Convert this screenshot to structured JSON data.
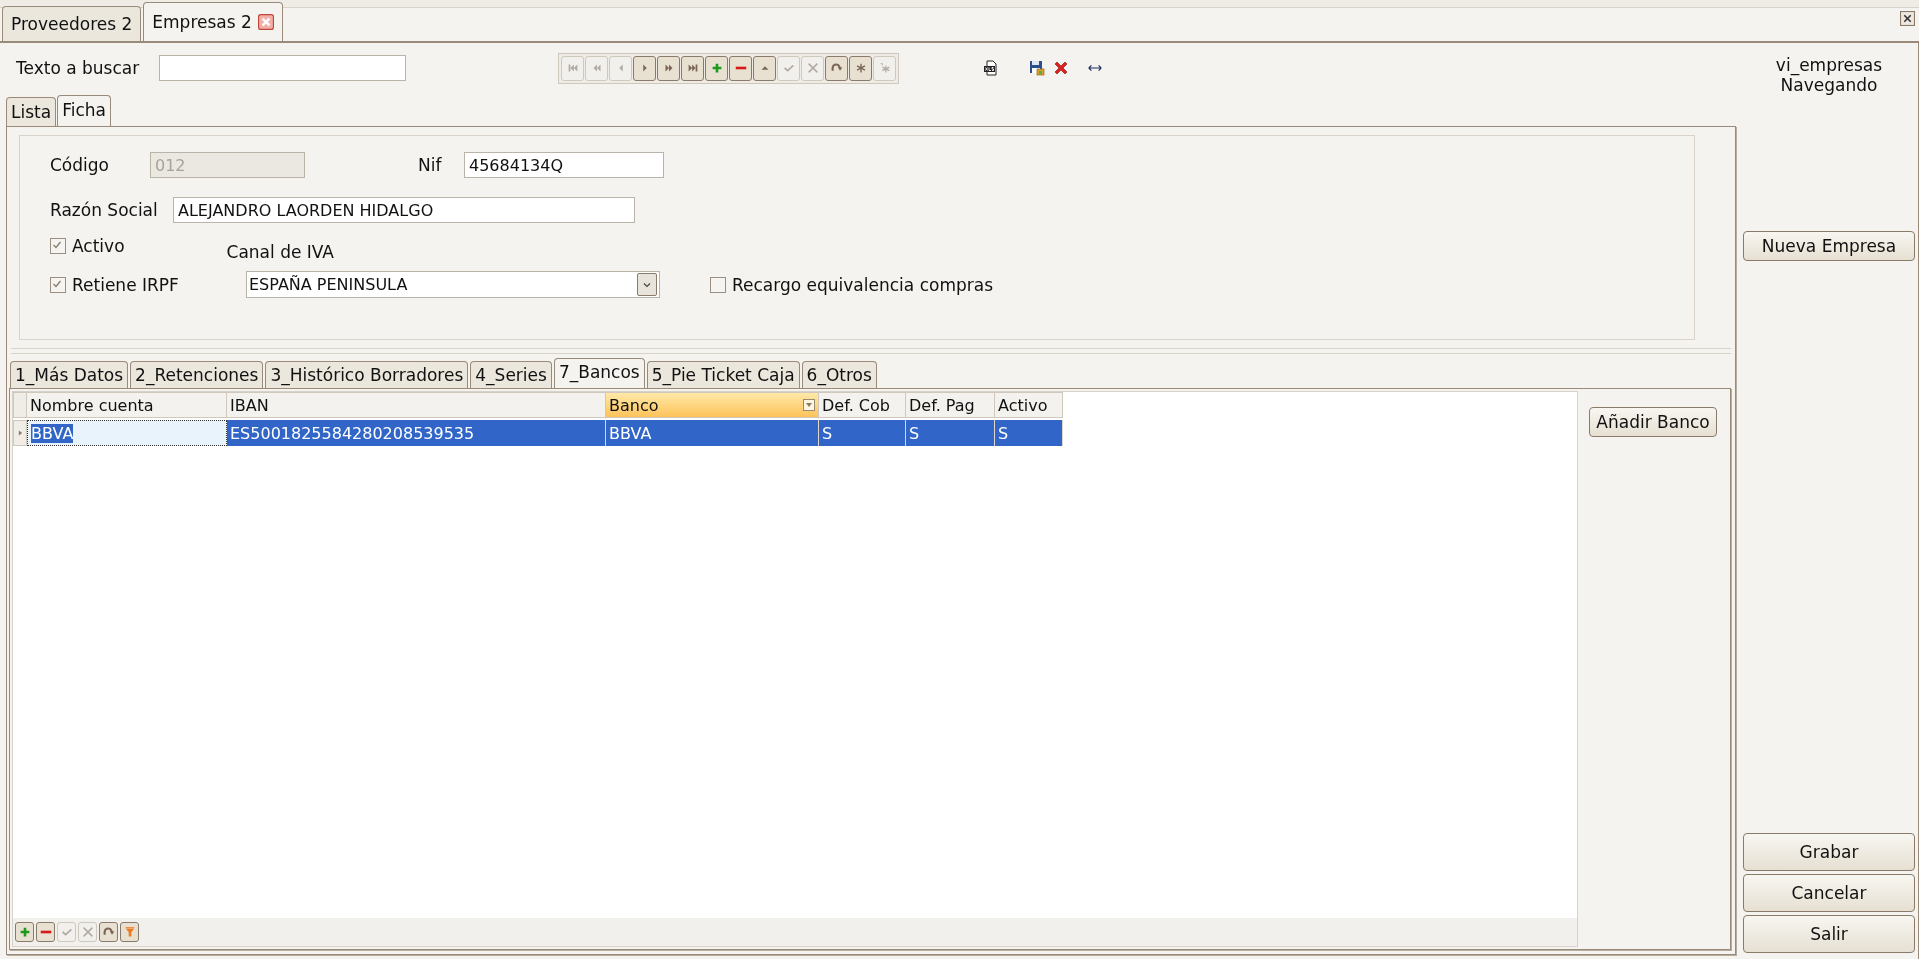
{
  "document_tabs": [
    {
      "label": "Proveedores 2",
      "selected": false,
      "closable": false
    },
    {
      "label": "Empresas 2",
      "selected": true,
      "closable": true
    }
  ],
  "search": {
    "label": "Texto a buscar"
  },
  "navigator": [
    {
      "kind": "first",
      "disabled": true
    },
    {
      "kind": "prev-page",
      "disabled": true
    },
    {
      "kind": "prev",
      "disabled": true
    },
    {
      "kind": "next",
      "disabled": false
    },
    {
      "kind": "next-page",
      "disabled": false
    },
    {
      "kind": "last",
      "disabled": false
    },
    {
      "kind": "add",
      "disabled": false
    },
    {
      "kind": "delete",
      "disabled": false
    },
    {
      "kind": "up",
      "disabled": false
    },
    {
      "kind": "post",
      "disabled": true
    },
    {
      "kind": "cancel",
      "disabled": true
    },
    {
      "kind": "refresh",
      "disabled": false
    },
    {
      "kind": "asterisk",
      "disabled": false
    },
    {
      "kind": "clone",
      "disabled": true
    }
  ],
  "actions": [
    {
      "kind": "excel"
    },
    {
      "kind": "save"
    },
    {
      "kind": "close"
    },
    {
      "kind": "resize"
    }
  ],
  "status": {
    "view": "vi_empresas",
    "mode": "Navegando"
  },
  "view_tabs": [
    {
      "label": "Lista",
      "selected": false
    },
    {
      "label": "Ficha",
      "selected": true
    }
  ],
  "form": {
    "codigo": {
      "label": "Código",
      "value": "012",
      "disabled": true
    },
    "nif": {
      "label": "Nif",
      "value": "45684134Q"
    },
    "razon_social": {
      "label": "Razón Social",
      "value": "ALEJANDRO LAORDEN HIDALGO"
    },
    "activo": {
      "label": "Activo",
      "checked": true
    },
    "canal_iva": {
      "label": "Canal de IVA",
      "value": "ESPAÑA PENINSULA"
    },
    "retiene_irpf": {
      "label": "Retiene IRPF",
      "checked": true
    },
    "recargo": {
      "label": "Recargo equivalencia compras",
      "checked": false
    }
  },
  "detail_tabs": [
    {
      "label": "1_Más Datos",
      "selected": false
    },
    {
      "label": "2_Retenciones",
      "selected": false
    },
    {
      "label": "3_Histórico Borradores",
      "selected": false
    },
    {
      "label": "4_Series",
      "selected": false
    },
    {
      "label": "7_Bancos",
      "selected": true
    },
    {
      "label": "5_Pie Ticket Caja",
      "selected": false
    },
    {
      "label": "6_Otros",
      "selected": false
    }
  ],
  "table": {
    "columns": [
      {
        "label": "Nombre cuenta",
        "selected": false
      },
      {
        "label": "IBAN",
        "selected": false
      },
      {
        "label": "Banco",
        "selected": true
      },
      {
        "label": "Def. Cob",
        "selected": false
      },
      {
        "label": "Def. Pag",
        "selected": false
      },
      {
        "label": "Activo",
        "selected": false
      }
    ],
    "rows": [
      {
        "selected": true,
        "cells": [
          "BBVA",
          "ES5001825584280208539535",
          "BBVA",
          "S",
          "S",
          "S"
        ]
      }
    ]
  },
  "grid_tools": [
    {
      "kind": "add",
      "disabled": false
    },
    {
      "kind": "delete",
      "disabled": false
    },
    {
      "kind": "post",
      "disabled": true
    },
    {
      "kind": "cancel",
      "disabled": true
    },
    {
      "kind": "refresh",
      "disabled": false
    },
    {
      "kind": "filter",
      "disabled": false
    }
  ],
  "buttons": {
    "add_bank": "Añadir Banco",
    "new_company": "Nueva Empresa",
    "save": "Grabar",
    "cancel": "Cancelar",
    "exit": "Salir"
  }
}
